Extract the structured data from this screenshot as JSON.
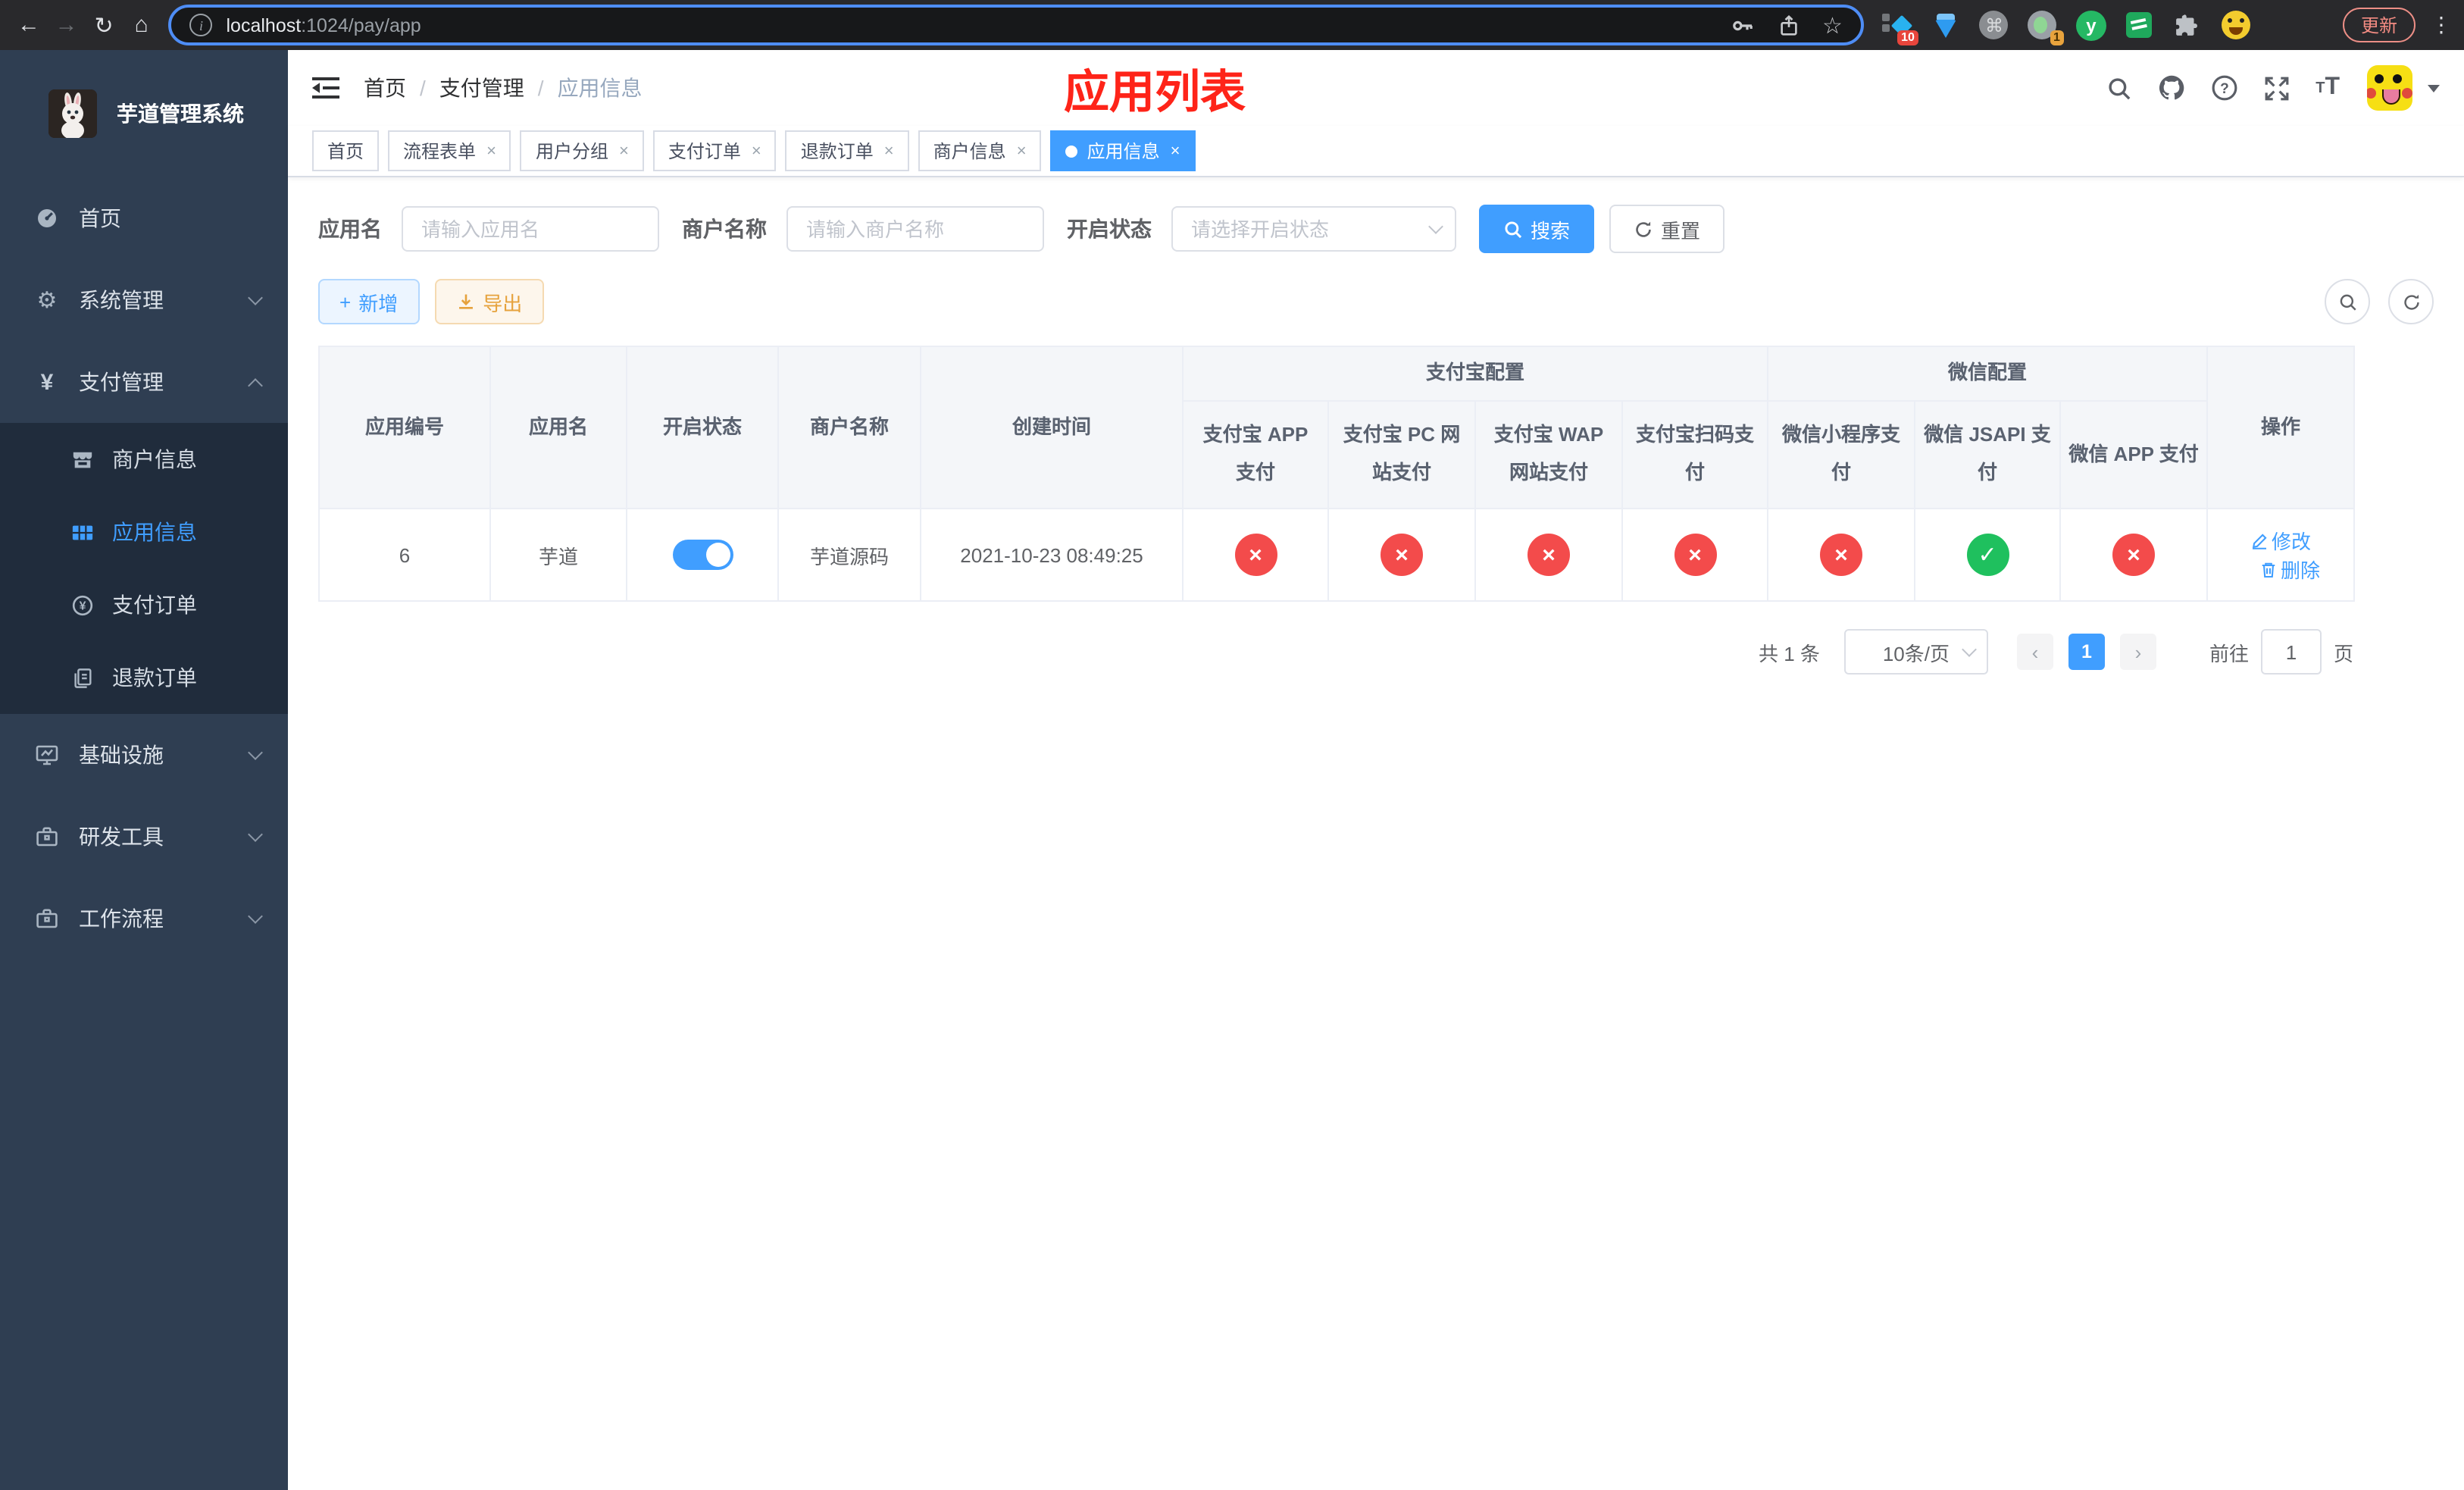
{
  "browser": {
    "url_host": "localhost",
    "url_rest": ":1024/pay/app",
    "update_label": "更新",
    "badge10": "10",
    "badge1": "1",
    "ext_y_letter": "y"
  },
  "sidebar": {
    "title": "芋道管理系统",
    "home": "首页",
    "system": "系统管理",
    "pay": "支付管理",
    "merchant": "商户信息",
    "app": "应用信息",
    "pay_order": "支付订单",
    "refund_order": "退款订单",
    "infra": "基础设施",
    "dev_tools": "研发工具",
    "workflow": "工作流程"
  },
  "navbar": {
    "breadcrumb": [
      "首页",
      "支付管理",
      "应用信息"
    ],
    "separator": "/",
    "annotation": "应用列表"
  },
  "tabs": [
    {
      "label": "首页"
    },
    {
      "label": "流程表单"
    },
    {
      "label": "用户分组"
    },
    {
      "label": "支付订单"
    },
    {
      "label": "退款订单"
    },
    {
      "label": "商户信息"
    },
    {
      "label": "应用信息"
    }
  ],
  "ui": {
    "tab_close": "×",
    "status_fail_glyph": "×",
    "status_success_glyph": "✓",
    "plus_glyph": "+"
  },
  "filters": {
    "app_name_label": "应用名",
    "app_name_placeholder": "请输入应用名",
    "merchant_label": "商户名称",
    "merchant_placeholder": "请输入商户名称",
    "status_label": "开启状态",
    "status_placeholder": "请选择开启状态",
    "search_label": "搜索",
    "reset_label": "重置"
  },
  "toolbar": {
    "add_label": "新增",
    "export_label": "导出"
  },
  "table": {
    "group_alipay": "支付宝配置",
    "group_wechat": "微信配置",
    "col_app_no": "应用编号",
    "col_app_name": "应用名",
    "col_status": "开启状态",
    "col_merchant": "商户名称",
    "col_created": "创建时间",
    "col_op": "操作",
    "sub": [
      "支付宝 APP 支付",
      "支付宝 PC 网站支付",
      "支付宝 WAP 网站支付",
      "支付宝扫码支付",
      "微信小程序支付",
      "微信 JSAPI 支付",
      "微信 APP 支付"
    ],
    "row": {
      "app_no": "6",
      "app_name": "芋道",
      "enabled": true,
      "merchant": "芋道源码",
      "created": "2021-10-23 08:49:25",
      "statuses": [
        "fail",
        "fail",
        "fail",
        "fail",
        "fail",
        "success",
        "fail"
      ],
      "edit_label": "修改",
      "delete_label": "删除"
    }
  },
  "pagination": {
    "total": "共 1 条",
    "page_size": "10条/页",
    "prev": "‹",
    "page": "1",
    "next": "›",
    "goto_label": "前往",
    "goto_value": "1",
    "unit_label": "页"
  },
  "colors": {
    "primary": "#409eff",
    "success": "#1fc05e",
    "danger": "#f34b4b",
    "warning": "#e6a23c",
    "annotation_red": "#fe2419",
    "sidebar_bg": "#2f3e52",
    "submenu_bg": "#202c3c"
  }
}
